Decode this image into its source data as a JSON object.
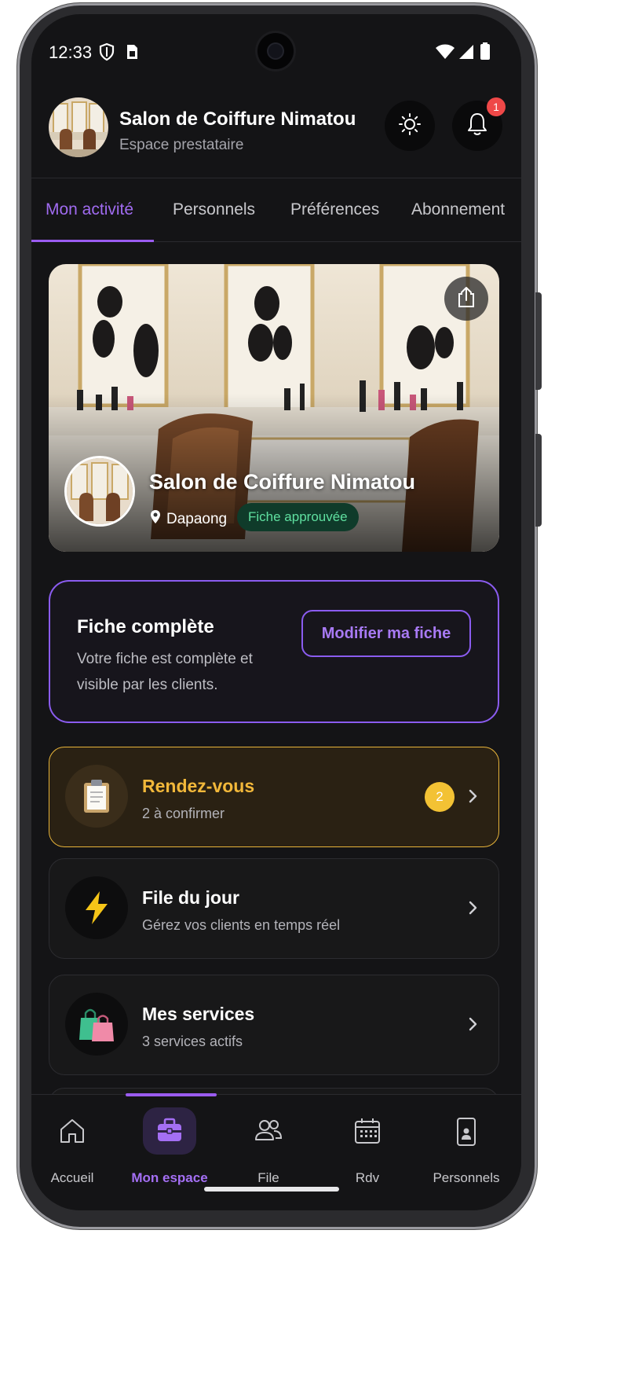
{
  "status_bar": {
    "time": "12:33"
  },
  "header": {
    "title": "Salon de Coiffure Nimatou",
    "subtitle": "Espace prestataire",
    "notification_count": "1"
  },
  "tabs": [
    {
      "label": "Mon activité",
      "active": true
    },
    {
      "label": "Personnels",
      "active": false
    },
    {
      "label": "Préférences",
      "active": false
    },
    {
      "label": "Abonnement",
      "active": false
    }
  ],
  "hero": {
    "title": "Salon de Coiffure Nimatou",
    "location": "Dapaong",
    "status_badge": "Fiche approuvée"
  },
  "profile_card": {
    "title": "Fiche complète",
    "description": "Votre fiche est complète et visible par les clients.",
    "button": "Modifier ma fiche"
  },
  "cards": [
    {
      "title": "Rendez-vous",
      "subtitle": "2 à confirmer",
      "count": "2",
      "icon": "clipboard-icon"
    },
    {
      "title": "File du jour",
      "subtitle": "Gérez vos clients en temps réel",
      "icon": "lightning-icon"
    },
    {
      "title": "Mes services",
      "subtitle": "3 services actifs",
      "icon": "shopping-bags-icon"
    }
  ],
  "bottom_nav": [
    {
      "label": "Accueil",
      "icon": "home-icon"
    },
    {
      "label": "Mon espace",
      "icon": "briefcase-icon",
      "active": true
    },
    {
      "label": "File",
      "icon": "users-icon"
    },
    {
      "label": "Rdv",
      "icon": "calendar-icon"
    },
    {
      "label": "Personnels",
      "icon": "phone-user-icon"
    }
  ],
  "colors": {
    "accent": "#9b5cf0",
    "warning": "#f2b83a",
    "success": "#5fe0a0",
    "background": "#141416"
  }
}
